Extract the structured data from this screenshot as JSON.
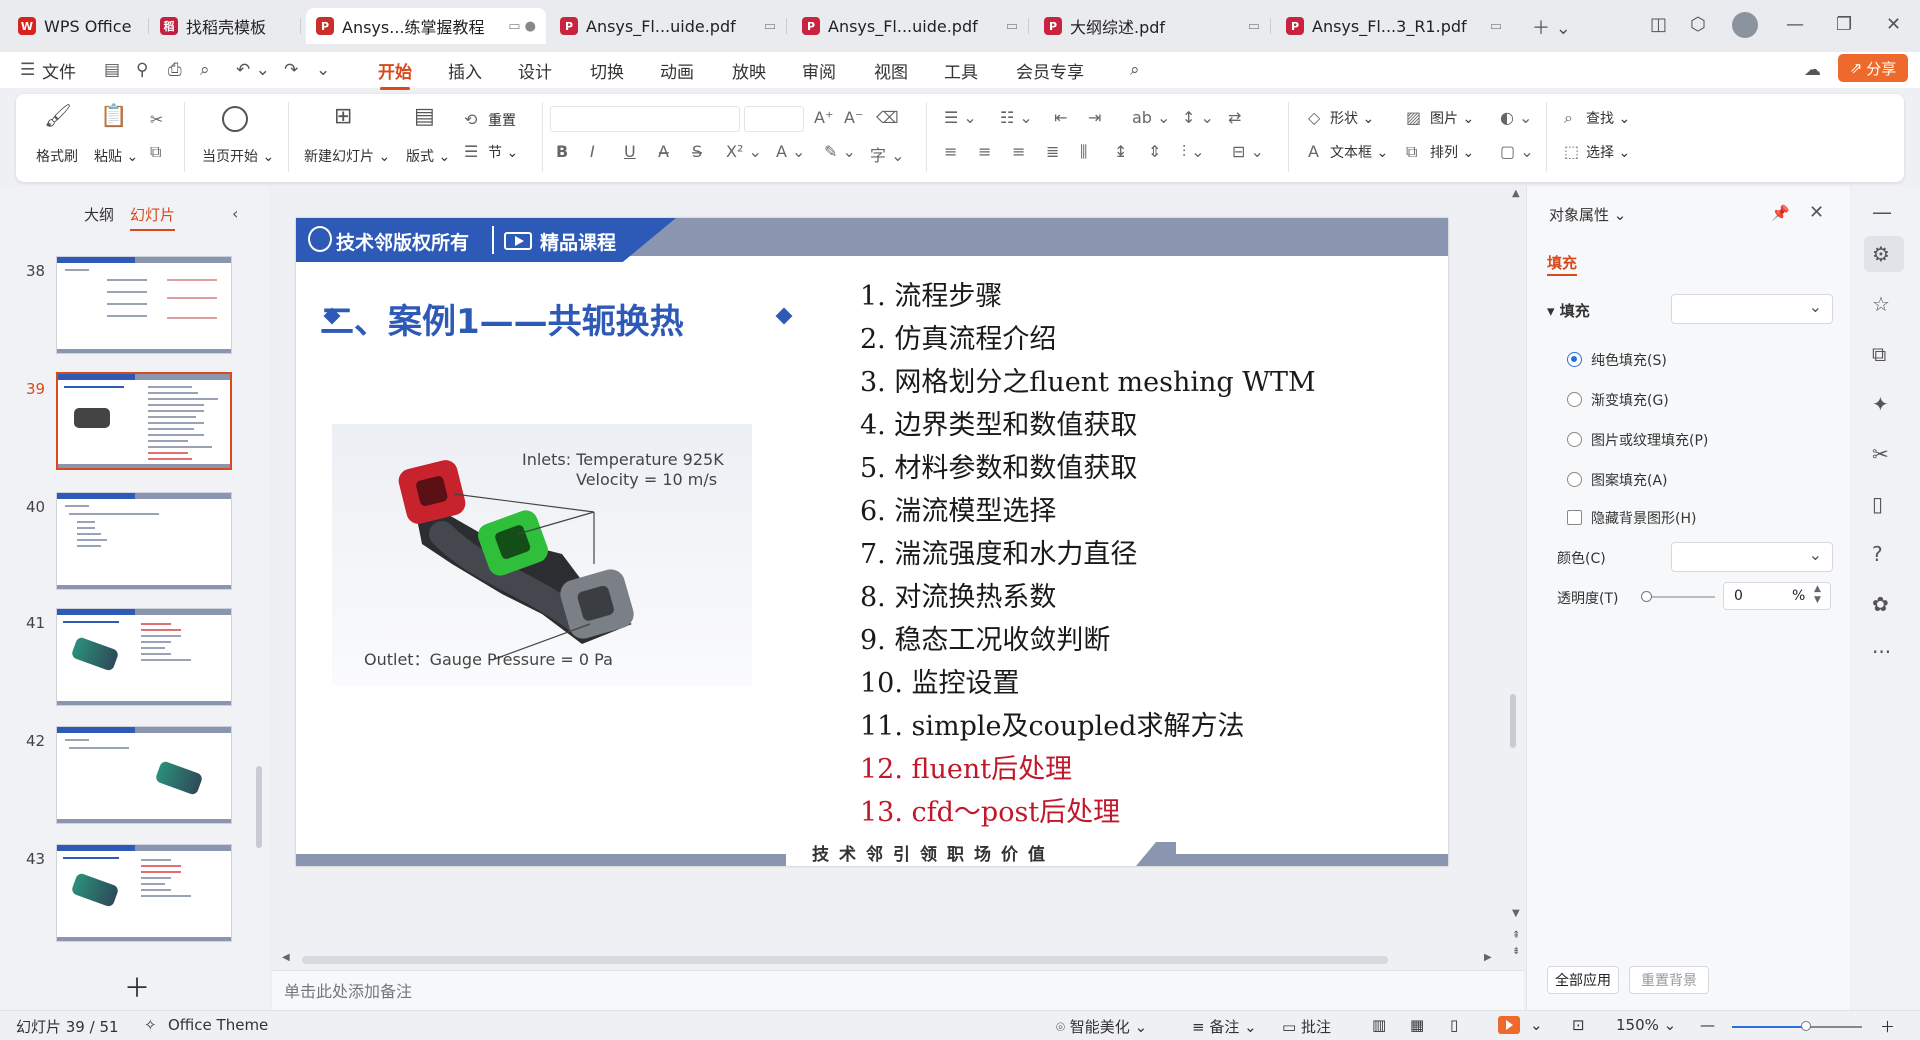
{
  "tabs": [
    {
      "label": "WPS Office",
      "color": "#d5241f",
      "glyph": "W"
    },
    {
      "label": "找稻壳模板",
      "color": "#c0213f",
      "glyph": "稻"
    },
    {
      "label": "Ansys...练掌握教程",
      "color": "#c9302c",
      "glyph": "P"
    },
    {
      "label": "Ansys_Fl...uide.pdf",
      "color": "#c9243f",
      "glyph": "P"
    },
    {
      "label": "Ansys_Fl...uide.pdf",
      "color": "#c9243f",
      "glyph": "P"
    },
    {
      "label": "大纲综述.pdf",
      "color": "#c9243f",
      "glyph": "P"
    },
    {
      "label": "Ansys_Fl...3_R1.pdf",
      "color": "#c9243f",
      "glyph": "P"
    }
  ],
  "menu": {
    "file": "文件",
    "items": [
      "开始",
      "插入",
      "设计",
      "切换",
      "动画",
      "放映",
      "审阅",
      "视图",
      "工具",
      "会员专享"
    ],
    "active": "开始",
    "share": "分享"
  },
  "ribbon": {
    "format_painter": "格式刷",
    "paste": "粘贴",
    "from_current": "当页开始",
    "new_slide": "新建幻灯片",
    "layout": "版式",
    "reset": "重置",
    "section": "节",
    "shape": "形状",
    "picture": "图片",
    "textbox": "文本框",
    "arrange": "排列",
    "find": "查找",
    "select": "选择"
  },
  "left_panel": {
    "tab_outline": "大纲",
    "tab_slides": "幻灯片",
    "slide_numbers": [
      "38",
      "39",
      "40",
      "41",
      "42",
      "43"
    ],
    "active_slide": "39"
  },
  "slide": {
    "brand": "技术邻版权所有",
    "course": "精品课程",
    "title": "二、案例1——共轭换热",
    "figure": {
      "inlet_line1": "Inlets: Temperature 925K",
      "inlet_line2": "Velocity = 10 m/s",
      "outlet": "Outlet：Gauge Pressure = 0 Pa"
    },
    "list": [
      {
        "text": "1. 流程步骤",
        "highlight": false
      },
      {
        "text": "2. 仿真流程介绍",
        "highlight": false
      },
      {
        "text": "3. 网格划分之fluent meshing WTM",
        "highlight": false
      },
      {
        "text": "4. 边界类型和数值获取",
        "highlight": false
      },
      {
        "text": "5. 材料参数和数值获取",
        "highlight": false
      },
      {
        "text": "6. 湍流模型选择",
        "highlight": false
      },
      {
        "text": "7. 湍流强度和水力直径",
        "highlight": false
      },
      {
        "text": "8. 对流换热系数",
        "highlight": false
      },
      {
        "text": "9. 稳态工况收敛判断",
        "highlight": false
      },
      {
        "text": "10. 监控设置",
        "highlight": false
      },
      {
        "text": "11. simple及coupled求解方法",
        "highlight": false
      },
      {
        "text": "12. fluent后处理",
        "highlight": true
      },
      {
        "text": "13. cfd～post后处理",
        "highlight": true
      }
    ],
    "footer": "技术邻引领职场价值"
  },
  "notes_placeholder": "单击此处添加备注",
  "properties": {
    "title": "对象属性",
    "tab_fill": "填充",
    "section_fill": "填充",
    "options": [
      "纯色填充(S)",
      "渐变填充(G)",
      "图片或纹理填充(P)",
      "图案填充(A)"
    ],
    "selected_option": "纯色填充(S)",
    "hide_background": "隐藏背景图形(H)",
    "color_label": "颜色(C)",
    "transparency_label": "透明度(T)",
    "transparency_value": "0",
    "transparency_unit": "%",
    "apply_all": "全部应用",
    "reset_background": "重置背景"
  },
  "status": {
    "slide_counter": "幻灯片 39 / 51",
    "theme": "Office Theme",
    "smart_beautify": "智能美化",
    "notes": "备注",
    "comments": "批注",
    "zoom": "150%",
    "zoom_fraction": 0.57
  },
  "colors": {
    "accent_orange": "#d8491b",
    "slide_blue": "#2d59b7",
    "highlight_red": "#c0182a"
  }
}
